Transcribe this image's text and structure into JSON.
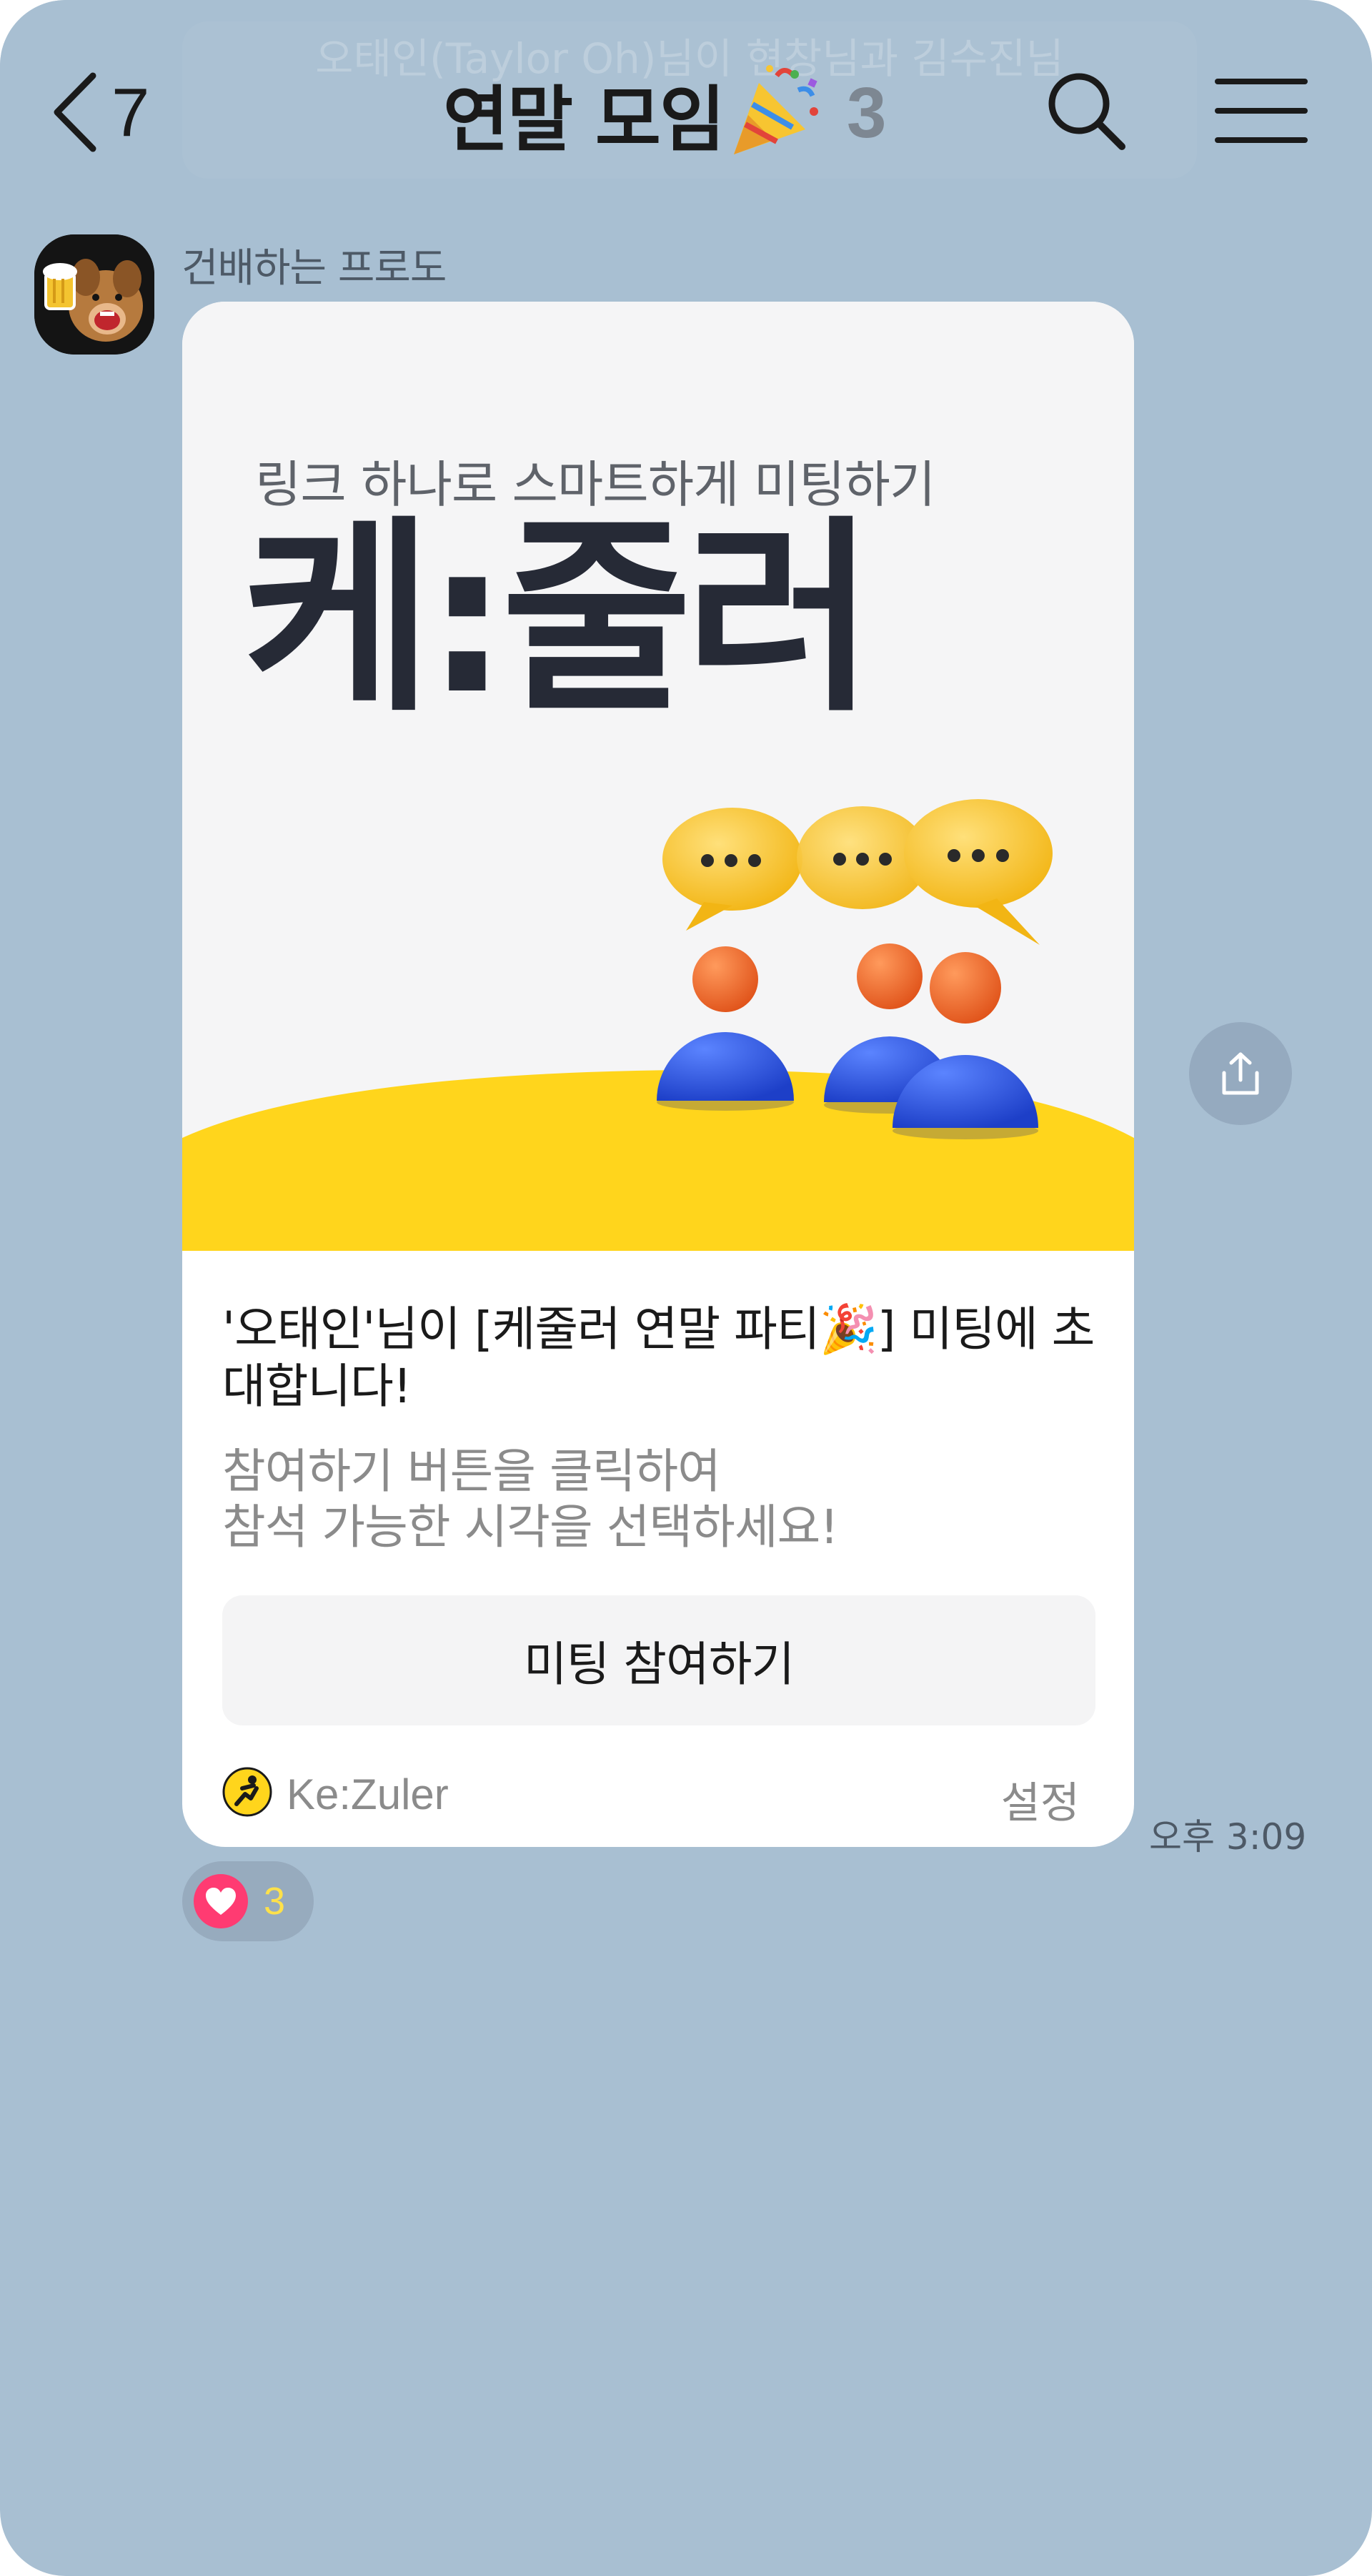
{
  "header": {
    "banner_text": "오태인(Taylor Oh)님이 현창님과 김수진님",
    "back_count": "7",
    "title": "연말 모임",
    "title_emoji": "🎉",
    "member_count": "3",
    "icons": {
      "back": "chevron-left-icon",
      "search": "search-icon",
      "menu": "hamburger-menu-icon"
    }
  },
  "message": {
    "sender_name": "건배하는 프로도",
    "avatar": "frodo-cheers-avatar",
    "timestamp": "오후 3:09",
    "card": {
      "hero_tagline": "링크 하나로 스마트하게 미팅하기",
      "hero_brand": "케:줄러",
      "invite_text": "'오태인'님이 [케줄러 연말 파티🎉] 미팅에 초대합니다!",
      "instruction_line1": "참여하기 버튼을 클릭하여",
      "instruction_line2": "참석 가능한 시각을 선택하세요!",
      "join_button": "미팅 참여하기",
      "app_name": "Ke:Zuler",
      "settings_label": "설정",
      "app_icon": "kezuler-logo-icon"
    },
    "share_icon": "share-icon",
    "reaction": {
      "icon": "heart-icon",
      "count": "3"
    }
  },
  "colors": {
    "chat_background": "#a8bfd2",
    "card_background": "#ffffff",
    "hero_background": "#f5f5f6",
    "accent_yellow": "#ffd51c",
    "bubble_yellow": "#f9c92a",
    "person_orange": "#f06a28",
    "person_blue": "#2e56e0",
    "heart_pink": "#ff3b72",
    "reaction_count": "#ffe14a"
  }
}
